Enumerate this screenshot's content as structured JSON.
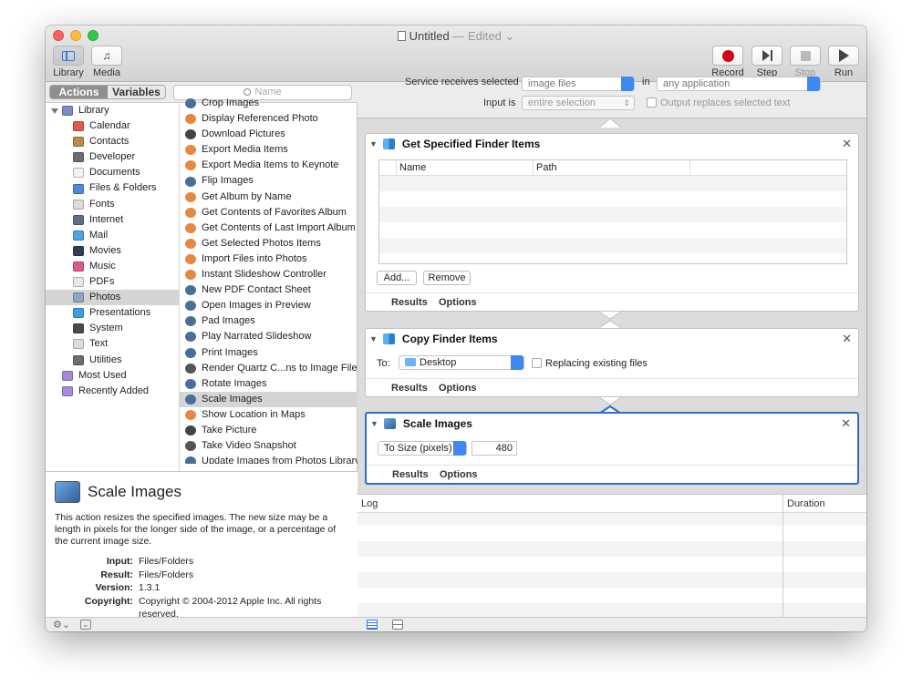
{
  "window": {
    "title": "Untitled",
    "edited": "— Edited"
  },
  "toolbar": {
    "library": "Library",
    "media": "Media",
    "record": "Record",
    "step": "Step",
    "stop": "Stop",
    "run": "Run"
  },
  "left": {
    "actions_tab": "Actions",
    "variables_tab": "Variables",
    "search_placeholder": "Name",
    "categories": [
      {
        "label": "Library",
        "color": "#7a8cc7",
        "indent": 0,
        "disclosure": true
      },
      {
        "label": "Calendar",
        "color": "#e45b4b",
        "indent": 1
      },
      {
        "label": "Contacts",
        "color": "#b88a4f",
        "indent": 1
      },
      {
        "label": "Developer",
        "color": "#6d6d6d",
        "indent": 1
      },
      {
        "label": "Documents",
        "color": "#f2f2f2",
        "indent": 1
      },
      {
        "label": "Files & Folders",
        "color": "#4f8ad8",
        "indent": 1
      },
      {
        "label": "Fonts",
        "color": "#dcdcdc",
        "indent": 1
      },
      {
        "label": "Internet",
        "color": "#5d6f86",
        "indent": 1
      },
      {
        "label": "Mail",
        "color": "#4ba3e8",
        "indent": 1
      },
      {
        "label": "Movies",
        "color": "#2f3e58",
        "indent": 1
      },
      {
        "label": "Music",
        "color": "#e05a87",
        "indent": 1
      },
      {
        "label": "PDFs",
        "color": "#e8e8e8",
        "indent": 1
      },
      {
        "label": "Photos",
        "color": "#8fa7c4",
        "indent": 1,
        "selected": true
      },
      {
        "label": "Presentations",
        "color": "#3b9ee0",
        "indent": 1
      },
      {
        "label": "System",
        "color": "#4a4a4a",
        "indent": 1
      },
      {
        "label": "Text",
        "color": "#dcdcdc",
        "indent": 1
      },
      {
        "label": "Utilities",
        "color": "#6d6d6d",
        "indent": 1
      },
      {
        "label": "Most Used",
        "color": "#a88ad8",
        "indent": 0
      },
      {
        "label": "Recently Added",
        "color": "#a88ad8",
        "indent": 0
      }
    ],
    "actions": [
      {
        "label": "Crop Images",
        "color": "#4a6e9c"
      },
      {
        "label": "Display Referenced Photo",
        "color": "#e9863f"
      },
      {
        "label": "Download Pictures",
        "color": "#444"
      },
      {
        "label": "Export Media Items",
        "color": "#e9863f"
      },
      {
        "label": "Export Media Items to Keynote",
        "color": "#e9863f"
      },
      {
        "label": "Flip Images",
        "color": "#4a6e9c"
      },
      {
        "label": "Get Album by Name",
        "color": "#e9863f"
      },
      {
        "label": "Get Contents of Favorites Album",
        "color": "#e9863f"
      },
      {
        "label": "Get Contents of Last Import Album",
        "color": "#e9863f"
      },
      {
        "label": "Get Selected Photos Items",
        "color": "#e9863f"
      },
      {
        "label": "Import Files into Photos",
        "color": "#e9863f"
      },
      {
        "label": "Instant Slideshow Controller",
        "color": "#e9863f"
      },
      {
        "label": "New PDF Contact Sheet",
        "color": "#4a6e9c"
      },
      {
        "label": "Open Images in Preview",
        "color": "#4a6e9c"
      },
      {
        "label": "Pad Images",
        "color": "#4a6e9c"
      },
      {
        "label": "Play Narrated Slideshow",
        "color": "#4a6e9c"
      },
      {
        "label": "Print Images",
        "color": "#4a6e9c"
      },
      {
        "label": "Render Quartz C...ns to Image Files",
        "color": "#555"
      },
      {
        "label": "Rotate Images",
        "color": "#4a6e9c"
      },
      {
        "label": "Scale Images",
        "color": "#4a6e9c",
        "selected": true
      },
      {
        "label": "Show Location in Maps",
        "color": "#e9863f"
      },
      {
        "label": "Take Picture",
        "color": "#444"
      },
      {
        "label": "Take Video Snapshot",
        "color": "#555"
      },
      {
        "label": "Update Images from Photos Library",
        "color": "#4a6e9c"
      }
    ],
    "description": {
      "title": "Scale Images",
      "text": "This action resizes the specified images. The new size may be a length in pixels for the longer side of the image, or a percentage of the current image size.",
      "input_label": "Input:",
      "input": "Files/Folders",
      "result_label": "Result:",
      "result": "Files/Folders",
      "version_label": "Version:",
      "version": "1.3.1",
      "copyright_label": "Copyright:",
      "copyright": "Copyright © 2004-2012 Apple Inc.  All rights reserved."
    }
  },
  "service": {
    "receives_label": "Service receives selected",
    "receives_value": "image files",
    "in_label": "in",
    "in_value": "any application",
    "input_label": "Input is",
    "input_value": "entire selection",
    "output_label": "Output replaces selected text"
  },
  "cards": {
    "get": {
      "title": "Get Specified Finder Items",
      "col_name": "Name",
      "col_path": "Path",
      "add": "Add...",
      "remove": "Remove",
      "results": "Results",
      "options": "Options"
    },
    "copy": {
      "title": "Copy Finder Items",
      "to_label": "To:",
      "to_value": "Desktop",
      "replace_label": "Replacing existing files",
      "results": "Results",
      "options": "Options"
    },
    "scale": {
      "title": "Scale Images",
      "mode": "To Size (pixels)",
      "size": "480",
      "results": "Results",
      "options": "Options"
    }
  },
  "log": {
    "col_log": "Log",
    "col_duration": "Duration"
  }
}
